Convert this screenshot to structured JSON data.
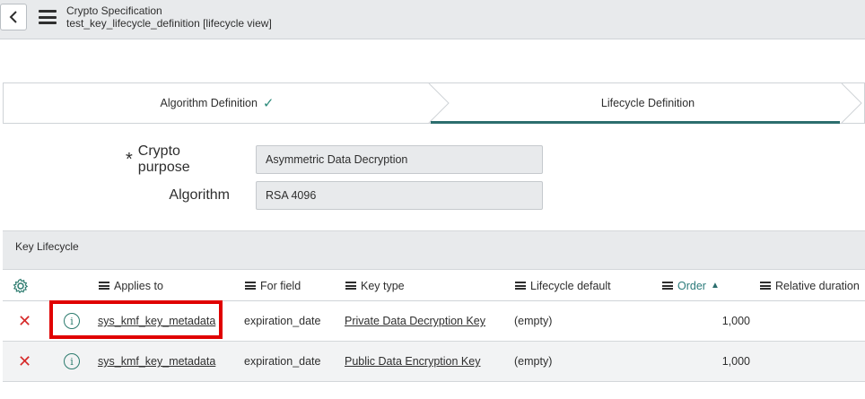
{
  "header": {
    "title": "Crypto Specification",
    "subtitle": "test_key_lifecycle_definition [lifecycle view]"
  },
  "steps": [
    {
      "label": "Algorithm Definition",
      "completed": true
    },
    {
      "label": "Lifecycle Definition",
      "active": true
    }
  ],
  "form": {
    "crypto_purpose_label": "Crypto purpose",
    "crypto_purpose_value": "Asymmetric Data Decryption",
    "algorithm_label": "Algorithm",
    "algorithm_value": "RSA 4096"
  },
  "related_list": {
    "title": "Key Lifecycle",
    "columns": {
      "applies_to": "Applies to",
      "for_field": "For field",
      "key_type": "Key type",
      "lifecycle_default": "Lifecycle default",
      "order": "Order",
      "relative_duration": "Relative duration"
    },
    "rows": [
      {
        "applies_to": "sys_kmf_key_metadata",
        "for_field": "expiration_date",
        "key_type": "Private Data Decryption Key",
        "lifecycle_default": "(empty)",
        "order": "1,000"
      },
      {
        "applies_to": "sys_kmf_key_metadata",
        "for_field": "expiration_date",
        "key_type": "Public Data Encryption Key",
        "lifecycle_default": "(empty)",
        "order": "1,000"
      }
    ]
  },
  "colors": {
    "accent": "#2c6e6e",
    "delete": "#d62a2a",
    "highlight": "#e00000"
  }
}
